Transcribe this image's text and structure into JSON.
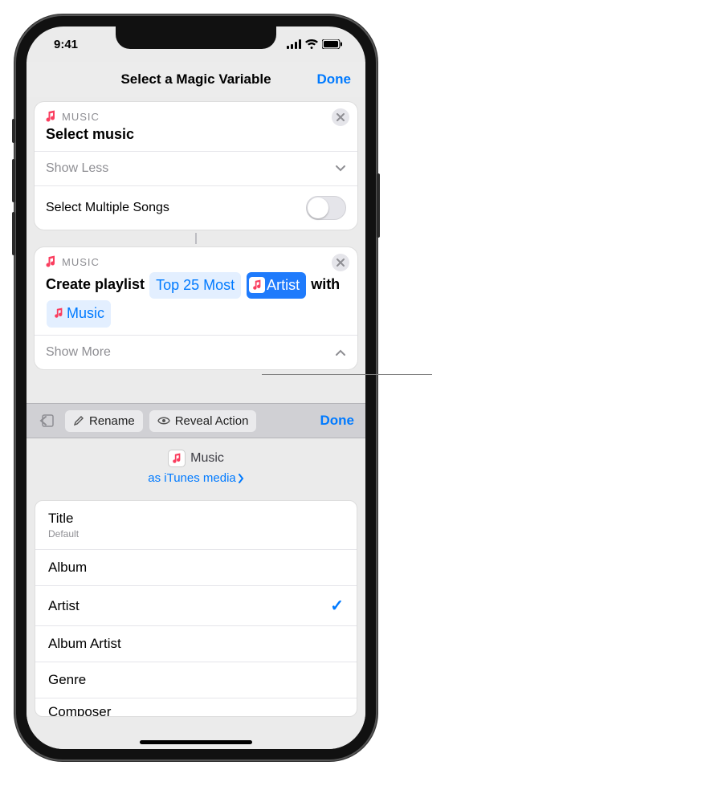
{
  "status": {
    "time": "9:41"
  },
  "nav": {
    "title": "Select a Magic Variable",
    "done": "Done"
  },
  "card1": {
    "app": "MUSIC",
    "title": "Select music",
    "showLess": "Show Less",
    "multiLabel": "Select Multiple Songs"
  },
  "card2": {
    "app": "MUSIC",
    "prefix": "Create playlist",
    "tokenTop": "Top 25 Most",
    "tokenArtist": "Artist",
    "mid": "with",
    "tokenMusic": "Music",
    "showMore": "Show More"
  },
  "accessory": {
    "rename": "Rename",
    "reveal": "Reveal Action",
    "done": "Done"
  },
  "varhead": {
    "name": "Music",
    "as": "as iTunes media"
  },
  "list": {
    "items": [
      {
        "label": "Title",
        "sub": "Default",
        "checked": false
      },
      {
        "label": "Album",
        "checked": false
      },
      {
        "label": "Artist",
        "checked": true
      },
      {
        "label": "Album Artist",
        "checked": false
      },
      {
        "label": "Genre",
        "checked": false
      },
      {
        "label": "Composer",
        "checked": false
      }
    ]
  }
}
